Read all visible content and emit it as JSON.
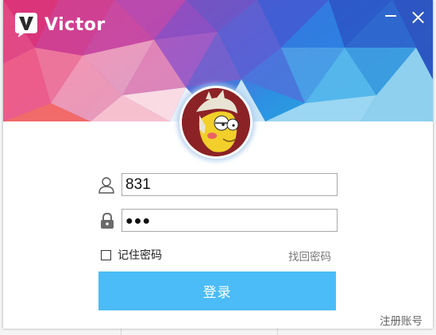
{
  "app": {
    "name": "Victor"
  },
  "window_controls": {
    "minimize": "minimize",
    "close": "close"
  },
  "login": {
    "username_value": "831",
    "password_mask": "●●●",
    "remember_label": "记住密码",
    "remember_checked": false,
    "find_password_label": "找回密码",
    "login_button_label": "登录",
    "register_label": "注册账号"
  },
  "icons": {
    "logo": "victor-logo-icon",
    "user": "user-icon",
    "lock": "lock-icon",
    "avatar": "avatar-cartoon"
  },
  "colors": {
    "accent": "#4bbcf7",
    "text": "#222222",
    "muted": "#777777"
  }
}
